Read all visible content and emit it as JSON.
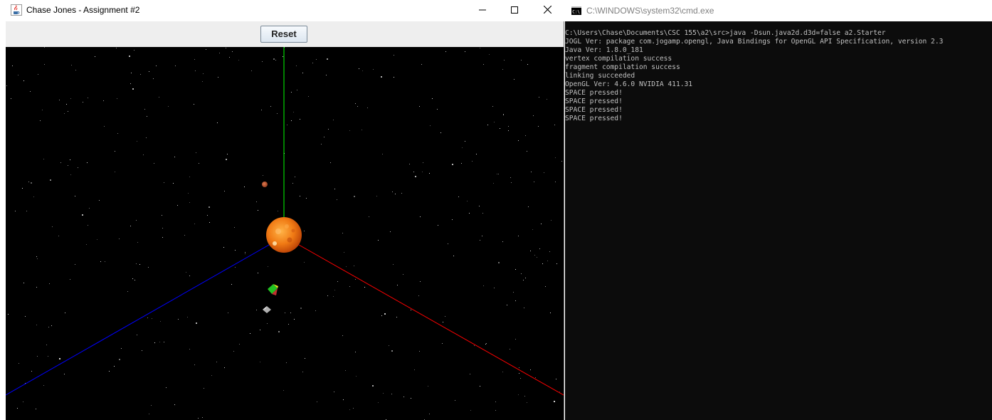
{
  "java_window": {
    "title": "Chase Jones - Assignment #2",
    "app_icon": "java-cup-icon",
    "controls": {
      "minimize": "minimize-icon",
      "maximize": "maximize-icon",
      "close": "close-icon"
    },
    "toolbar": {
      "reset_label": "Reset"
    },
    "scene": {
      "background_color": "#000000",
      "axes": {
        "x_color": "#ff0000",
        "y_color": "#00ff00",
        "z_color": "#0000ff"
      },
      "objects": [
        "sun",
        "small-planet",
        "green-cube",
        "moon"
      ]
    }
  },
  "cmd_window": {
    "title": "C:\\WINDOWS\\system32\\cmd.exe",
    "icon": "cmd-icon",
    "lines": [
      "C:\\Users\\Chase\\Documents\\CSC 155\\a2\\src>java -Dsun.java2d.d3d=false a2.Starter",
      "JOGL Ver: package com.jogamp.opengl, Java Bindings for OpenGL API Specification, version 2.3",
      "Java Ver: 1.8.0_181",
      "vertex compilation success",
      "fragment compilation success",
      "linking succeeded",
      "OpenGL Ver: 4.6.0 NVIDIA 411.31",
      "SPACE pressed!",
      "SPACE pressed!",
      "SPACE pressed!",
      "SPACE pressed!"
    ]
  }
}
